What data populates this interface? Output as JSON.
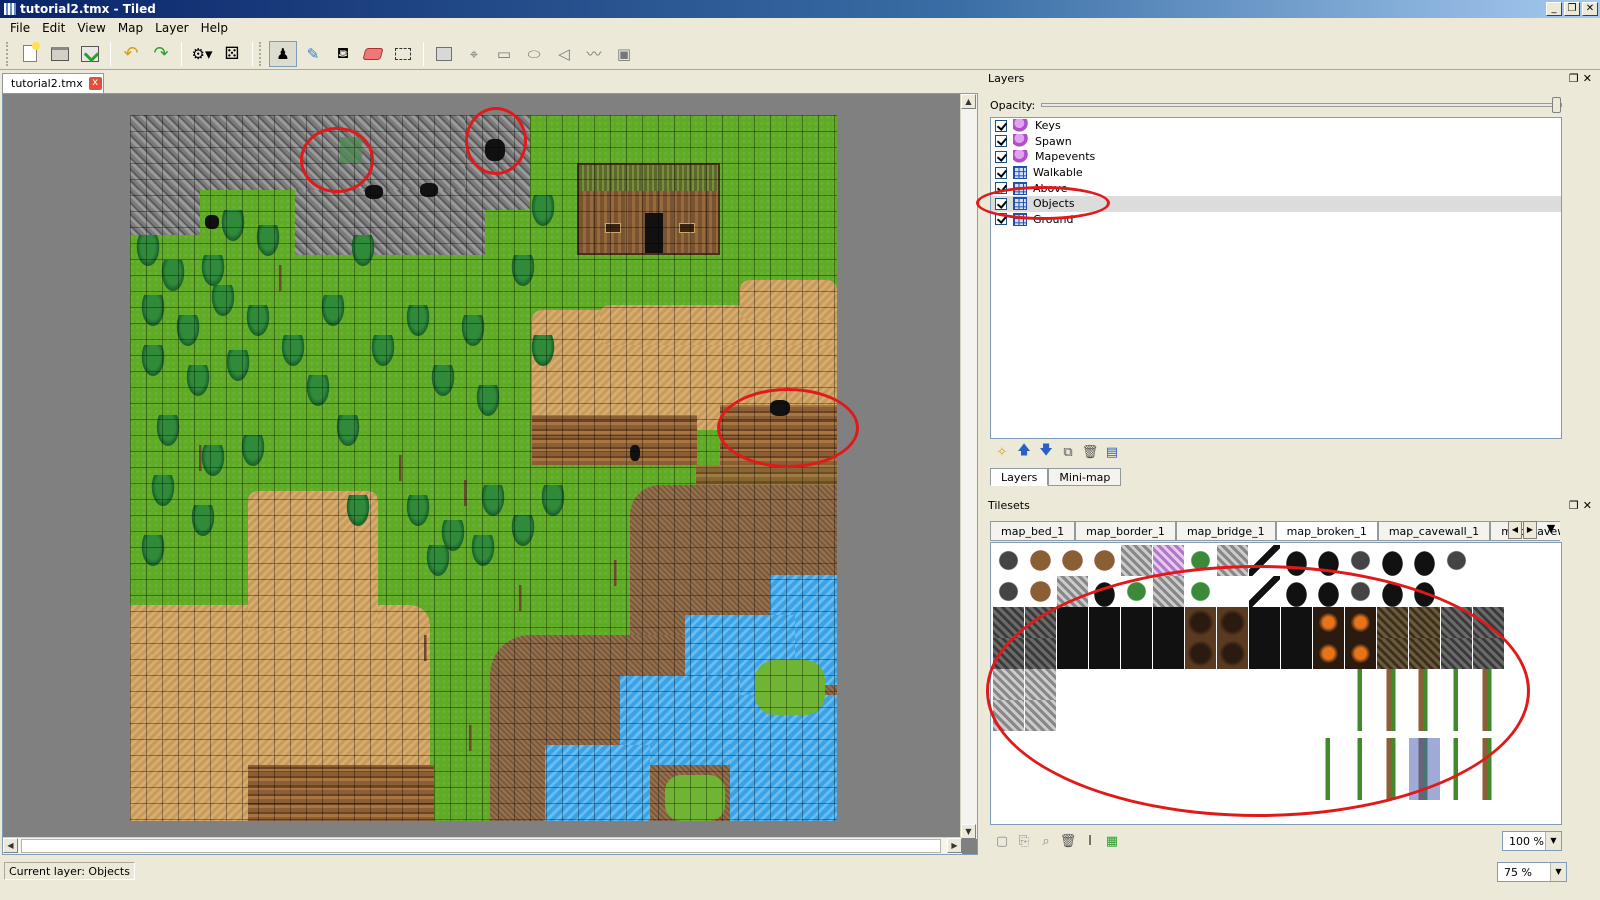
{
  "window": {
    "title": "tutorial2.tmx - Tiled",
    "controls": [
      "_",
      "❐",
      "✕"
    ]
  },
  "menu": [
    "File",
    "Edit",
    "View",
    "Map",
    "Layer",
    "Help"
  ],
  "document_tab": {
    "label": "tutorial2.tmx",
    "close": "x"
  },
  "layers_panel": {
    "title": "Layers",
    "opacity_label": "Opacity:",
    "opacity_value": 1.0,
    "layers": [
      {
        "name": "Keys",
        "type": "object",
        "visible": true,
        "selected": false
      },
      {
        "name": "Spawn",
        "type": "object",
        "visible": true,
        "selected": false
      },
      {
        "name": "Mapevents",
        "type": "object",
        "visible": true,
        "selected": false
      },
      {
        "name": "Walkable",
        "type": "tile",
        "visible": true,
        "selected": false
      },
      {
        "name": "Above",
        "type": "tile",
        "visible": true,
        "selected": false
      },
      {
        "name": "Objects",
        "type": "tile",
        "visible": true,
        "selected": true
      },
      {
        "name": "Ground",
        "type": "tile",
        "visible": true,
        "selected": false
      }
    ],
    "tabs": [
      "Layers",
      "Mini-map"
    ]
  },
  "tilesets_panel": {
    "title": "Tilesets",
    "tabs": [
      "map_bed_1",
      "map_border_1",
      "map_bridge_1",
      "map_broken_1",
      "map_cavewall_1",
      "map_cavew"
    ],
    "active_tab": 3,
    "zoom": "100 %"
  },
  "status": {
    "current_layer": "Current layer: Objects",
    "zoom": "75 %"
  },
  "colors": {
    "annotation": "#e01a1a",
    "grass": "#5fab25",
    "water": "#3aa3e8",
    "dirt": "#c89a5b"
  }
}
